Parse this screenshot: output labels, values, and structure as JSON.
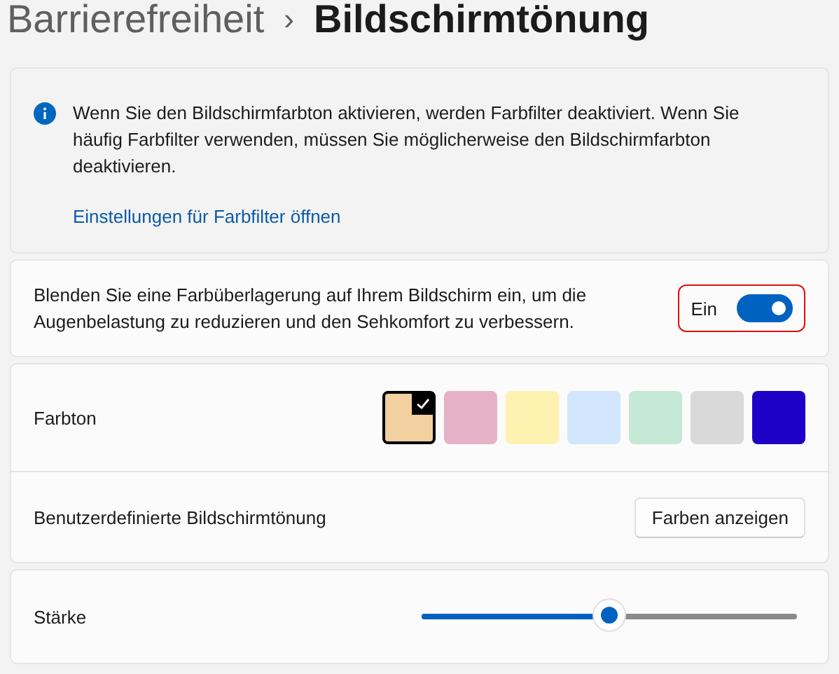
{
  "breadcrumb": {
    "parent": "Barrierefreiheit",
    "separator": "›",
    "current": "Bildschirmtönung"
  },
  "info": {
    "text": "Wenn Sie den Bildschirmfarbton aktivieren, werden Farbfilter deaktiviert. Wenn Sie häufig Farbfilter verwenden, müssen Sie möglicherweise den Bildschirmfarbton deaktivieren.",
    "link": "Einstellungen für Farbfilter öffnen"
  },
  "overlay": {
    "text": "Blenden Sie eine Farbüberlagerung auf Ihrem Bildschirm ein, um die Augenbelastung zu reduzieren und den Sehkomfort zu verbessern.",
    "toggle_label": "Ein",
    "on": true,
    "highlighted": true
  },
  "tint": {
    "label": "Farbton",
    "swatches": [
      {
        "color": "#f2d0a0",
        "selected": true
      },
      {
        "color": "#e6b2c8",
        "selected": false
      },
      {
        "color": "#fff1b0",
        "selected": false
      },
      {
        "color": "#d2e6fe",
        "selected": false
      },
      {
        "color": "#c6e8d6",
        "selected": false
      },
      {
        "color": "#d9d9d9",
        "selected": false
      },
      {
        "color": "#1f00c7",
        "selected": false
      }
    ]
  },
  "custom": {
    "label": "Benutzerdefinierte Bildschirmtönung",
    "button": "Farben anzeigen"
  },
  "strength": {
    "label": "Stärke",
    "level": 0.5
  }
}
